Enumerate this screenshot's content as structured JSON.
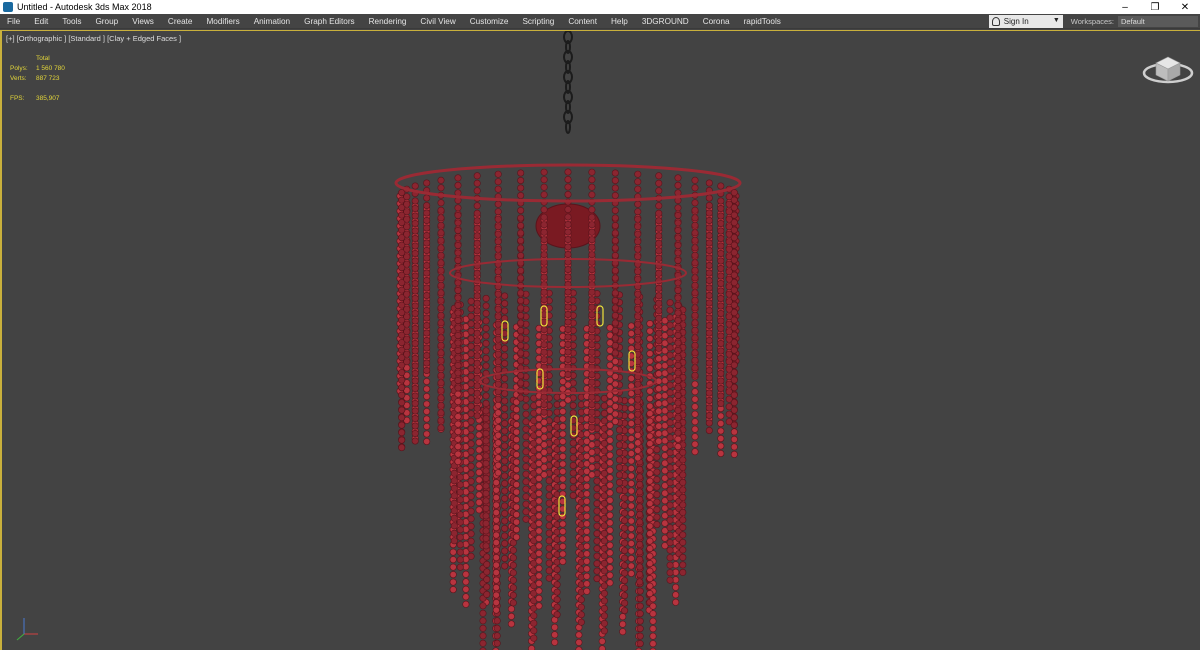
{
  "window": {
    "title": "Untitled - Autodesk 3ds Max 2018",
    "minimize": "–",
    "restore": "❐",
    "close": "✕"
  },
  "menu": {
    "items": [
      "File",
      "Edit",
      "Tools",
      "Group",
      "Views",
      "Create",
      "Modifiers",
      "Animation",
      "Graph Editors",
      "Rendering",
      "Civil View",
      "Customize",
      "Scripting",
      "Content",
      "Help",
      "3DGROUND",
      "Corona",
      "rapidTools"
    ],
    "sign_in": "Sign In",
    "workspaces_label": "Workspaces:",
    "workspaces_value": "Default"
  },
  "viewport": {
    "label": "[+] [Orthographic ] [Standard ] [Clay + Edged Faces ]",
    "stats": {
      "total_label": "Total",
      "polys_label": "Polys:",
      "polys_value": "1 560 780",
      "verts_label": "Verts:",
      "verts_value": "887 723",
      "fps_label": "FPS:",
      "fps_value": "385,907"
    }
  },
  "colors": {
    "viewport_bg": "#434343",
    "active_border": "#c9b03c",
    "stats_text": "#e3d63a",
    "mesh_red": "#b8343f",
    "mesh_dark": "#5a141c",
    "light_yellow": "#f0e23a"
  },
  "icons": {
    "app": "3ds-max-icon",
    "sign_in": "user-icon",
    "viewcube": "viewcube-icon",
    "axis": "axis-tripod-icon"
  }
}
